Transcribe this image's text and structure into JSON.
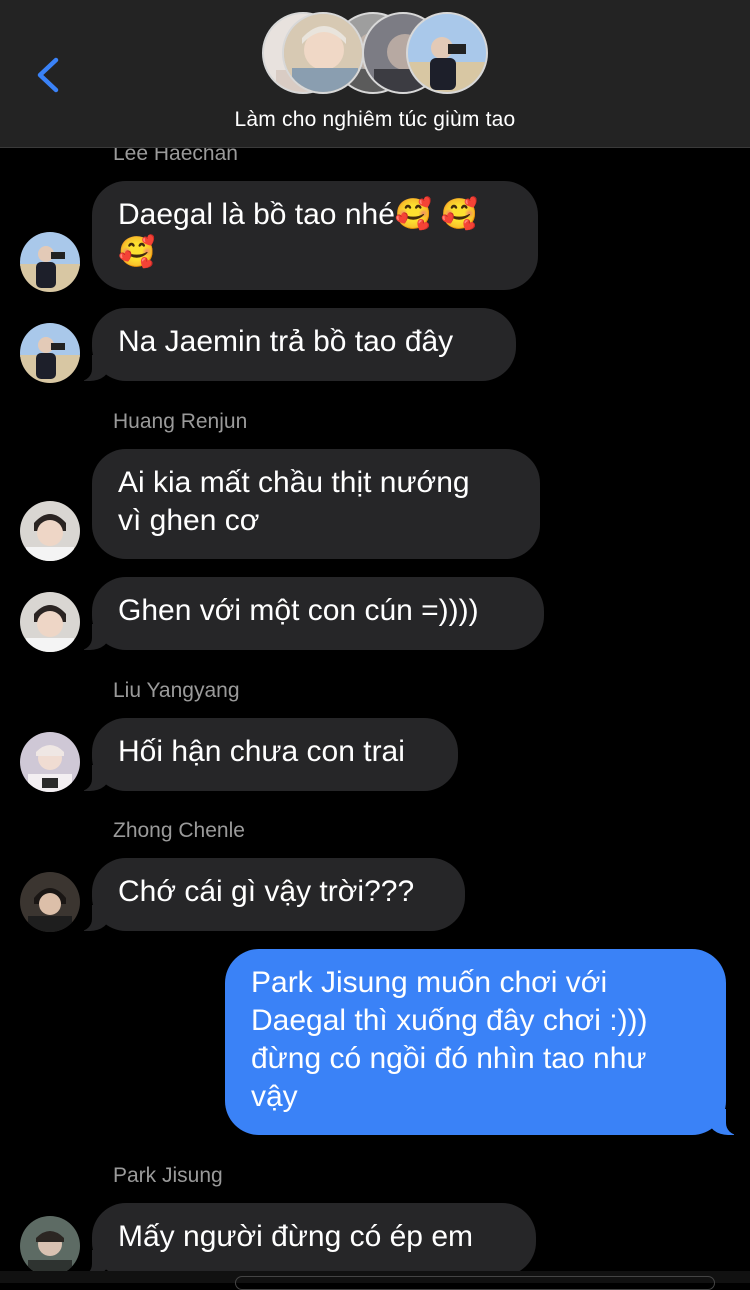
{
  "header": {
    "title": "Làm cho nghiêm túc giùm tao",
    "back_icon": "chevron-left-icon",
    "accent": "#3a82f7"
  },
  "messages": [
    {
      "sender": "Lee Haechan",
      "text": "Daegal là bồ tao nhé🥰🥰🥰",
      "side": "them"
    },
    {
      "text": "Na Jaemin trả bồ tao đây",
      "side": "them"
    },
    {
      "sender": "Huang Renjun",
      "text": "Ai kia mất chầu thịt nướng vì ghen cơ",
      "side": "them"
    },
    {
      "text": "Ghen với một con cún =))))",
      "side": "them"
    },
    {
      "sender": "Liu Yangyang",
      "text": "Hối hận chưa con trai",
      "side": "them"
    },
    {
      "sender": "Zhong Chenle",
      "text": "Chớ cái gì vậy trời???",
      "side": "them"
    },
    {
      "text": "Park Jisung muốn chơi với Daegal thì xuống đây chơi :))) đừng có ngồi đó nhìn tao như vậy",
      "side": "me"
    },
    {
      "sender": "Park Jisung",
      "text": "Mấy người đừng có ép em",
      "side": "them"
    }
  ],
  "msg_lines": {
    "m0_l1": "Daegal là bồ tao nhé",
    "m0_e1": "🥰",
    "m0_e2": "🥰",
    "m0_e3": "🥰",
    "m2_l1": "Ai kia mất chầu thịt nướng",
    "m2_l2": "vì ghen cơ",
    "m6_l1": "Park Jisung muốn chơi với",
    "m6_l2": "Daegal thì xuống đây chơi :)))",
    "m6_l3": "đừng có ngồi đó nhìn tao như",
    "m6_l4": "vậy"
  },
  "colors": {
    "bubble_them": "#262628",
    "bubble_me": "#3a82f7",
    "sender_label": "#9a9a9a",
    "header_bg": "#232323"
  }
}
